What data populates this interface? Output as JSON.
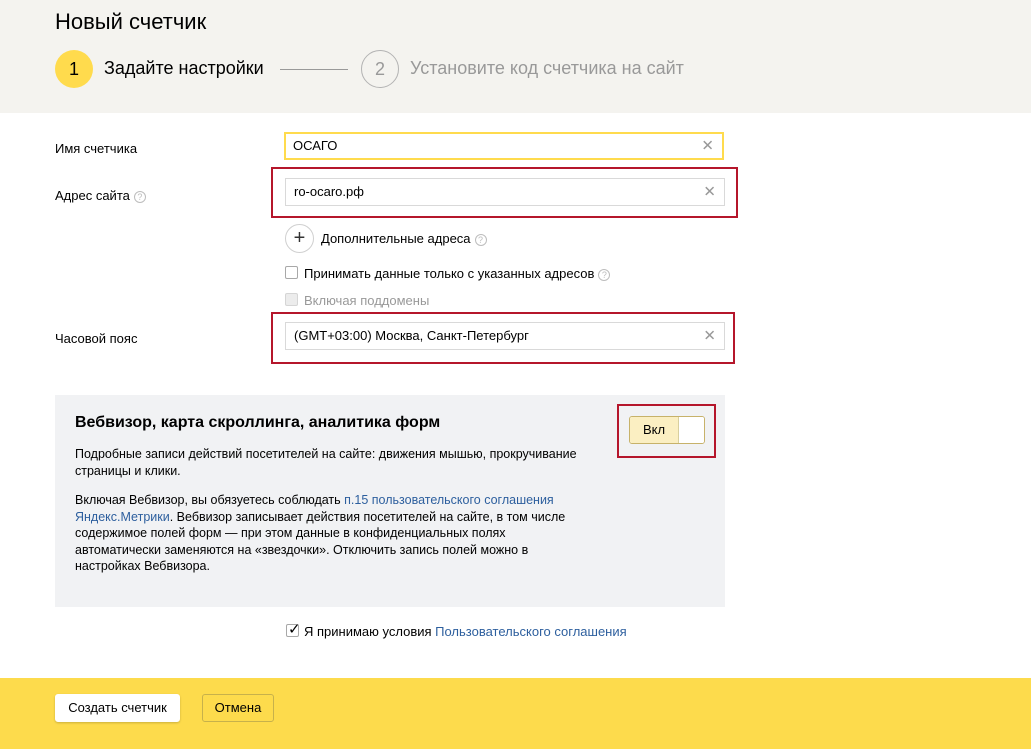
{
  "header": {
    "title": "Новый счетчик",
    "steps": [
      {
        "number": "1",
        "label": "Задайте настройки"
      },
      {
        "number": "2",
        "label": "Установите код счетчика на сайт"
      }
    ]
  },
  "form": {
    "counter_name": {
      "label": "Имя счетчика",
      "value": "ОСАГО"
    },
    "site_address": {
      "label": "Адрес сайта",
      "value": "ro-ocaro.pф",
      "help": "?"
    },
    "additional_addresses": {
      "label": "Дополнительные адреса",
      "help": "?"
    },
    "accept_only_listed": {
      "label": "Принимать данные только с указанных адресов",
      "help": "?",
      "checked": false
    },
    "include_subdomains": {
      "label": "Включая поддомены",
      "checked": false,
      "disabled": true
    },
    "timezone": {
      "label": "Часовой пояс",
      "value": "(GMT+03:00) Москва, Санкт-Петербург"
    }
  },
  "webvisor": {
    "title": "Вебвизор, карта скроллинга, аналитика форм",
    "description": "Подробные записи действий посетителей на сайте: движения мышью, прокручивание страницы и клики.",
    "terms_prefix": "Включая Вебвизор, вы обязуетесь соблюдать ",
    "terms_link": "п.15 пользовательского соглашения Яндекс.Метрики",
    "terms_suffix": ". Вебвизор записывает действия посетителей на сайте, в том числе содержимое полей форм — при этом данные в конфиденциальных полях автоматически заменяются на «звездочки». Отключить запись полей можно в настройках Вебвизора.",
    "toggle_label": "Вкл",
    "toggle_on": true
  },
  "agreement": {
    "prefix": "Я принимаю условия ",
    "link": "Пользовательского соглашения",
    "checked": true
  },
  "footer": {
    "create_label": "Создать счетчик",
    "cancel_label": "Отмена"
  },
  "colors": {
    "accent_yellow": "#ffdb4d",
    "footer_yellow": "#fddb4c",
    "highlight_red": "#b5162b",
    "link_blue": "#2d5f9e"
  }
}
